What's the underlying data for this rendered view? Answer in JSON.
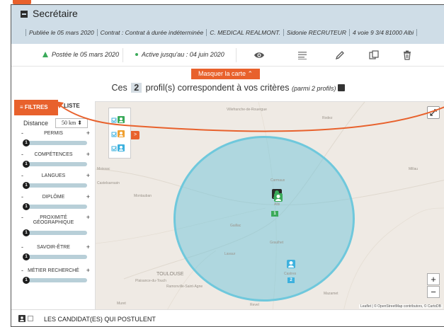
{
  "header": {
    "title": "Secrétaire",
    "meta": [
      "Publiée le 05 mars 2020",
      "Contrat : Contrat à durée indéterminée",
      "C. MEDICAL REALMONT.",
      "Sidonie RECRUTEUR",
      "4 voie 9 3/4 81000 Albi"
    ]
  },
  "actions": {
    "posted": "Postée le 05 mars 2020",
    "active_until": "Active jusqu'au : 04 juin 2020",
    "icons": [
      "eye-icon",
      "list-icon",
      "pencil-icon",
      "duplicate-icon",
      "trash-icon"
    ]
  },
  "map_toggle": {
    "label": "Masquer la carte ⌃"
  },
  "results": {
    "prefix": "Ces",
    "count": "2",
    "suffix": "profil(s) correspondent à vos critères",
    "sub": "(parmi 2 profils)"
  },
  "filters": {
    "tab_filters": "≡ FILTRES",
    "tab_list": "LISTE",
    "distance_label": "Distance",
    "distance_value": "50 km ⬍",
    "items": [
      {
        "label": "PERMIS",
        "knob": "1"
      },
      {
        "label": "COMPÉTENCES",
        "knob": "1"
      },
      {
        "label": "LANGUES",
        "knob": "1"
      },
      {
        "label": "DIPLÔME",
        "knob": "1"
      },
      {
        "label": "PROXIMITÉ GÉOGRAPHIQUE",
        "knob": "1"
      },
      {
        "label": "SAVOIR-ÊTRE",
        "knob": "1"
      },
      {
        "label": "MÉTIER RECHERCHÉ",
        "knob": "1"
      }
    ],
    "minus": "-",
    "plus": "+"
  },
  "map": {
    "places": [
      {
        "name": "Villefranche-de-Rouergue"
      },
      {
        "name": "Rodez"
      },
      {
        "name": "Moissac"
      },
      {
        "name": "Castelsarrasin"
      },
      {
        "name": "Montauban"
      },
      {
        "name": "Carmaux"
      },
      {
        "name": "Gaillac"
      },
      {
        "name": "Albi"
      },
      {
        "name": "Millau"
      },
      {
        "name": "Graulhet"
      },
      {
        "name": "Lavaur"
      },
      {
        "name": "TOULOUSE"
      },
      {
        "name": "Plaisance-du-Touch"
      },
      {
        "name": "Ramonville-Saint-Agne"
      },
      {
        "name": "Castres"
      },
      {
        "name": "Muret"
      },
      {
        "name": "Revel"
      },
      {
        "name": "Mazamet"
      }
    ],
    "pins": [
      {
        "badge": "1",
        "color": "#3aaa5a"
      },
      {
        "badge": "2",
        "color": "#3db1de"
      }
    ],
    "zoom_in": "+",
    "zoom_out": "−",
    "attribution": "Leaflet | © OpenStreetMap contributors, © CartoDB"
  },
  "legend": {
    "items": [
      {
        "color": "#3aaa5a",
        "icon": "candidate-icon"
      },
      {
        "color": "#f0a030",
        "icon": "candidate-icon"
      },
      {
        "color": "#3db1de",
        "icon": "candidate-icon"
      }
    ],
    "toggle": ">"
  },
  "candidates": {
    "label": "LES CANDIDAT(ES) QUI POSTULENT"
  },
  "colors": {
    "accent": "#e8612c",
    "header_bg": "#cfdde7",
    "circle": "#6fc8dc"
  }
}
